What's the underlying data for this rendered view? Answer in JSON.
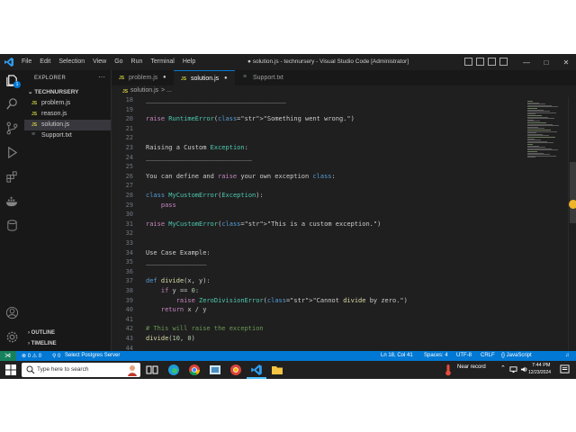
{
  "window": {
    "title": "● solution.js - technursery - Visual Studio Code [Administrator]",
    "menu": [
      "File",
      "Edit",
      "Selection",
      "View",
      "Go",
      "Run",
      "Terminal",
      "Help"
    ],
    "controls": [
      "—",
      "□",
      "✕"
    ]
  },
  "activity_bar": {
    "items": [
      "files-icon",
      "search-icon",
      "source-control-icon",
      "run-debug-icon",
      "extensions-icon",
      "docker-icon",
      "database-icon"
    ],
    "bottom": [
      "account-icon",
      "settings-icon"
    ],
    "badge": "1"
  },
  "explorer": {
    "title": "EXPLORER",
    "more": "···",
    "folder": "TECHNURSERY",
    "files": [
      {
        "icon": "JS",
        "name": "problem.js"
      },
      {
        "icon": "JS",
        "name": "reason.js"
      },
      {
        "icon": "JS",
        "name": "solution.js"
      },
      {
        "icon": "≡",
        "name": "Support.txt"
      }
    ],
    "outline": "OUTLINE",
    "timeline": "TIMELINE"
  },
  "tabs": [
    {
      "icon": "JS",
      "name": "problem.js",
      "dot": "●"
    },
    {
      "icon": "JS",
      "name": "solution.js",
      "dot": "●"
    },
    {
      "icon": "≡",
      "name": "Support.txt"
    }
  ],
  "breadcrumb": {
    "icon": "JS",
    "file": "solution.js",
    "sep": "> ..."
  },
  "editor": {
    "lines": [
      {
        "n": "18",
        "text": "_____________________________________"
      },
      {
        "n": "19",
        "text": ""
      },
      {
        "n": "20",
        "text": "raise RuntimeError(\"Something went wrong.\")"
      },
      {
        "n": "21",
        "text": ""
      },
      {
        "n": "22",
        "text": ""
      },
      {
        "n": "23",
        "text": "Raising a Custom Exception:"
      },
      {
        "n": "24",
        "text": "____________________________"
      },
      {
        "n": "25",
        "text": ""
      },
      {
        "n": "26",
        "text": "You can define and raise your own exception class:"
      },
      {
        "n": "27",
        "text": ""
      },
      {
        "n": "28",
        "text": "class MyCustomError(Exception):"
      },
      {
        "n": "29",
        "text": "    pass"
      },
      {
        "n": "30",
        "text": ""
      },
      {
        "n": "31",
        "text": "raise MyCustomError(\"This is a custom exception.\")"
      },
      {
        "n": "32",
        "text": ""
      },
      {
        "n": "33",
        "text": ""
      },
      {
        "n": "34",
        "text": "Use Case Example:"
      },
      {
        "n": "35",
        "text": "________________"
      },
      {
        "n": "36",
        "text": ""
      },
      {
        "n": "37",
        "text": "def divide(x, y):"
      },
      {
        "n": "38",
        "text": "    if y == 0:"
      },
      {
        "n": "39",
        "text": "        raise ZeroDivisionError(\"Cannot divide by zero.\")"
      },
      {
        "n": "40",
        "text": "    return x / y"
      },
      {
        "n": "41",
        "text": ""
      },
      {
        "n": "42",
        "text": "# This will raise the exception"
      },
      {
        "n": "43",
        "text": "divide(10, 0)"
      },
      {
        "n": "44",
        "text": ""
      }
    ]
  },
  "statusbar": {
    "remote": "⋊",
    "problems": "⊗ 0 ⚠ 0",
    "ports": "⚲ 0",
    "postgres": "Select Postgres Server",
    "position": "Ln 18, Col 41",
    "spaces": "Spaces: 4",
    "encoding": "UTF-8",
    "eol": "CRLF",
    "language": "{} JavaScript",
    "bell": "♫"
  },
  "taskbar": {
    "search_placeholder": "Type here to search",
    "weather": "Near record",
    "time": "7:44 PM",
    "date": "12/23/2024"
  },
  "colors": {
    "accent": "#0078d4",
    "editor_bg": "#1f1f1f",
    "sidebar_bg": "#181818",
    "statusbar": "#0078d4",
    "taskbar": "#202020"
  }
}
